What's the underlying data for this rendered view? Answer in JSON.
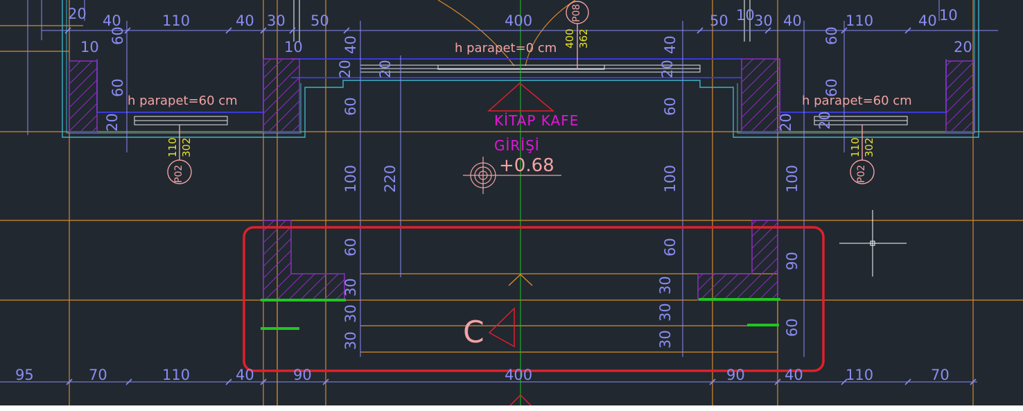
{
  "labels": {
    "room_name_line1": "KİTAP KAFE",
    "room_name_line2": "GİRİŞİ",
    "level": "+0.68",
    "section_mark": "C",
    "parapet_center": "h parapet=0 cm",
    "parapet_left": "h parapet=60 cm",
    "parapet_right": "h parapet=60 cm"
  },
  "tags": {
    "window_left": "P02",
    "window_center": "P08",
    "window_right": "P02",
    "left_w": "110",
    "left_h": "302",
    "center_w": "400",
    "center_h": "362",
    "right_w": "110",
    "right_h": "302"
  },
  "top_dims": [
    "20",
    "40",
    "110",
    "40",
    "30",
    "50",
    "400",
    "50",
    "10",
    "30",
    "40",
    "110",
    "40",
    "10",
    "10",
    "10",
    "20"
  ],
  "bottom_dims": [
    "95",
    "70",
    "110",
    "40",
    "90",
    "400",
    "90",
    "40",
    "110",
    "70"
  ],
  "vertical_dims": {
    "left_60_top": "60",
    "left_60_mid": "60",
    "left_20": "20",
    "c1_40": "40",
    "c1_20": "20",
    "c1_60": "60",
    "c1_100": "100",
    "c1_60b": "60",
    "c1_30a": "30",
    "c1_30b": "30",
    "c1_30c": "30",
    "c2_20": "20",
    "c2_220": "220",
    "c3_40": "40",
    "c3_20": "20",
    "c3_60": "60",
    "c3_100": "100",
    "c3_60b": "60",
    "c3_30a": "30",
    "c3_30b": "30",
    "c3_30c": "30",
    "r_60_top": "60",
    "r_60_mid": "60",
    "r_20": "20",
    "r_20b": "20",
    "r_100": "100",
    "r_90": "90",
    "r_60": "60"
  },
  "colors": {
    "background": "#212830",
    "grid": "#d88a2c",
    "dimension": "#8a8cf2",
    "hatch": "#8e2fbf",
    "highlight": "#e0202a",
    "axis": "#21c521",
    "text_pink": "#f3a3a3",
    "text_magenta": "#e316d8",
    "text_yellow": "#e6e22a"
  },
  "highlight_region": "annotated-entrance-area"
}
